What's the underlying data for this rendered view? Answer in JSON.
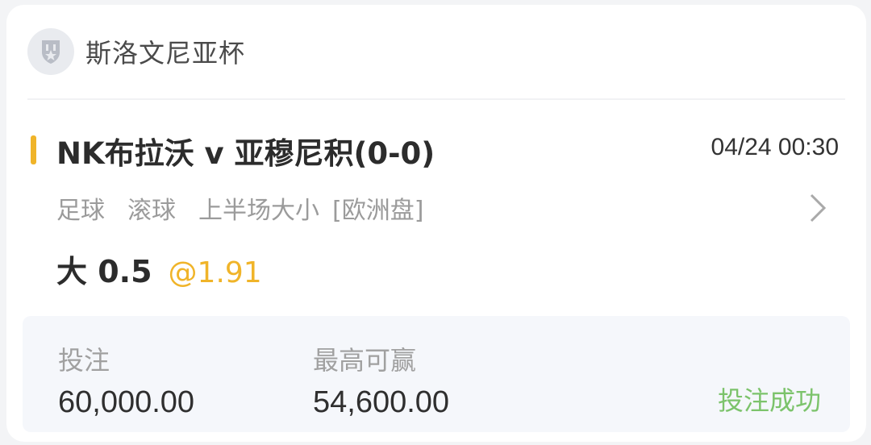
{
  "league": {
    "name": "斯洛文尼亚杯",
    "icon": "trophy-shield-icon"
  },
  "match": {
    "title": "NK布拉沃 v 亚穆尼积(0-0)",
    "time": "04/24 00:30",
    "sport": "足球",
    "mode": "滚球",
    "market": "上半场大小",
    "odds_type": "[欧洲盘]"
  },
  "selection": {
    "name": "大 0.5",
    "odds": "@1.91"
  },
  "summary": {
    "stake_label": "投注",
    "stake_value": "60,000.00",
    "max_win_label": "最高可赢",
    "max_win_value": "54,600.00",
    "status": "投注成功"
  },
  "colors": {
    "accent": "#f0b429",
    "success": "#7cc36b",
    "muted": "#9b9b9b"
  }
}
